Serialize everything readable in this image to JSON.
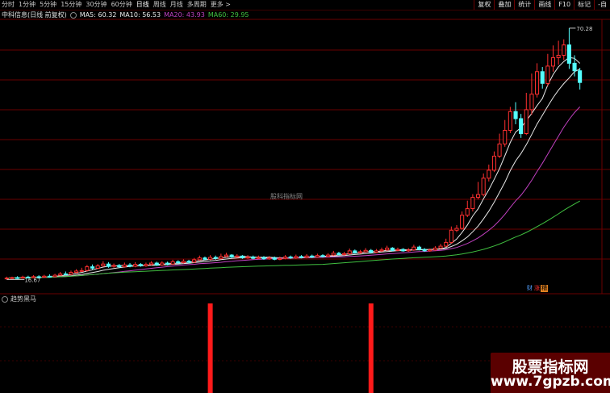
{
  "toolbar": {
    "tabs": [
      "分时",
      "1分钟",
      "5分钟",
      "15分钟",
      "30分钟",
      "60分钟",
      "日线",
      "周线",
      "月线",
      "多周期",
      "更多 >"
    ],
    "active_tab": "日线",
    "right_buttons": [
      "复权",
      "叠加",
      "统计",
      "画线",
      "F10",
      "标记",
      "-自"
    ]
  },
  "info": {
    "title": "中科信息(日线 前复权)",
    "ma5": "MA5: 60.32",
    "ma10": "MA10: 56.53",
    "ma20": "MA20: 43.93",
    "ma60": "MA60: 29.95"
  },
  "colors": {
    "ma5": "#e8e8e8",
    "ma10": "#e8e8e8",
    "ma20": "#c040c0",
    "ma60": "#40c040",
    "up": "#ff3030",
    "down": "#54ffff",
    "signal": "#ff1a1a",
    "grid": "#6a0000"
  },
  "chart_annotations": {
    "high_label": "70.28",
    "low_label": "16.67",
    "watermark": "股科指标网"
  },
  "badges": [
    "财",
    "涨",
    "糟"
  ],
  "indicator": {
    "title": "趋势黑马"
  },
  "logo": {
    "line1": "股票指标网",
    "line2": "www.7gpzb.com"
  },
  "chart_data": {
    "type": "candlestick",
    "price_axis": {
      "low": 16.67,
      "high": 70.28
    },
    "candles": [
      [
        16.9,
        17.0,
        17.3,
        16.7
      ],
      [
        17.0,
        17.1,
        17.3,
        16.8
      ],
      [
        17.1,
        17.0,
        17.4,
        16.8
      ],
      [
        17.0,
        17.2,
        17.5,
        16.9
      ],
      [
        17.2,
        17.1,
        17.5,
        17.0
      ],
      [
        17.1,
        17.3,
        17.6,
        17.0
      ],
      [
        17.3,
        17.2,
        17.6,
        17.0
      ],
      [
        17.2,
        17.4,
        17.7,
        17.1
      ],
      [
        17.4,
        17.3,
        17.8,
        17.1
      ],
      [
        17.3,
        17.6,
        17.9,
        17.2
      ],
      [
        17.6,
        17.9,
        18.3,
        17.5
      ],
      [
        17.9,
        17.8,
        18.4,
        17.6
      ],
      [
        17.8,
        18.2,
        18.6,
        17.7
      ],
      [
        18.2,
        18.5,
        18.9,
        18.0
      ],
      [
        18.5,
        18.6,
        19.2,
        18.3
      ],
      [
        18.6,
        19.4,
        19.8,
        18.4
      ],
      [
        19.4,
        19.1,
        19.9,
        18.8
      ],
      [
        19.1,
        19.6,
        20.0,
        18.9
      ],
      [
        19.6,
        20.0,
        20.6,
        19.4
      ],
      [
        20.0,
        19.5,
        20.4,
        19.2
      ],
      [
        19.5,
        19.7,
        20.1,
        19.2
      ],
      [
        19.7,
        19.4,
        20.0,
        19.1
      ],
      [
        19.4,
        19.8,
        20.3,
        19.2
      ],
      [
        19.8,
        19.5,
        20.2,
        19.3
      ],
      [
        19.5,
        19.9,
        20.4,
        19.3
      ],
      [
        19.9,
        19.6,
        20.2,
        19.4
      ],
      [
        19.6,
        19.9,
        20.3,
        19.4
      ],
      [
        19.9,
        20.2,
        20.6,
        19.7
      ],
      [
        20.2,
        19.8,
        20.5,
        19.6
      ],
      [
        19.8,
        20.2,
        20.6,
        19.6
      ],
      [
        20.2,
        20.0,
        20.5,
        19.7
      ],
      [
        20.0,
        20.5,
        20.9,
        19.8
      ],
      [
        20.5,
        20.3,
        20.8,
        20.0
      ],
      [
        20.3,
        20.6,
        21.0,
        20.1
      ],
      [
        20.6,
        20.4,
        20.9,
        20.1
      ],
      [
        20.4,
        20.9,
        21.3,
        20.2
      ],
      [
        20.9,
        21.3,
        21.8,
        20.7
      ],
      [
        21.3,
        21.0,
        21.6,
        20.8
      ],
      [
        21.0,
        21.4,
        21.9,
        20.8
      ],
      [
        21.4,
        21.2,
        21.8,
        20.9
      ],
      [
        21.2,
        21.6,
        22.2,
        21.0
      ],
      [
        21.6,
        21.9,
        22.4,
        21.4
      ],
      [
        21.9,
        21.5,
        22.1,
        21.3
      ],
      [
        21.5,
        21.7,
        22.1,
        21.3
      ],
      [
        21.7,
        21.3,
        21.9,
        21.1
      ],
      [
        21.3,
        21.5,
        21.9,
        21.1
      ],
      [
        21.5,
        21.2,
        21.8,
        21.0
      ],
      [
        21.2,
        21.4,
        21.8,
        21.0
      ],
      [
        21.4,
        21.1,
        21.7,
        20.9
      ],
      [
        21.1,
        21.3,
        21.7,
        20.9
      ],
      [
        21.3,
        21.0,
        21.6,
        20.8
      ],
      [
        21.0,
        21.2,
        21.6,
        20.8
      ],
      [
        21.2,
        21.5,
        21.9,
        21.0
      ],
      [
        21.5,
        21.3,
        21.8,
        21.1
      ],
      [
        21.3,
        21.6,
        22.0,
        21.1
      ],
      [
        21.6,
        21.4,
        21.9,
        21.2
      ],
      [
        21.4,
        21.7,
        22.1,
        21.2
      ],
      [
        21.7,
        21.5,
        22.0,
        21.3
      ],
      [
        21.5,
        21.8,
        22.2,
        21.3
      ],
      [
        21.8,
        21.6,
        22.1,
        21.4
      ],
      [
        21.6,
        21.9,
        22.3,
        21.4
      ],
      [
        21.9,
        22.3,
        22.8,
        21.7
      ],
      [
        22.3,
        22.0,
        22.6,
        21.8
      ],
      [
        22.0,
        22.2,
        22.6,
        21.8
      ],
      [
        22.2,
        22.8,
        23.3,
        22.0
      ],
      [
        22.8,
        22.4,
        23.1,
        22.2
      ],
      [
        22.4,
        22.6,
        23.0,
        22.2
      ],
      [
        22.6,
        22.9,
        23.4,
        22.4
      ],
      [
        22.9,
        22.5,
        23.2,
        22.3
      ],
      [
        22.5,
        22.8,
        23.2,
        22.3
      ],
      [
        22.8,
        23.0,
        23.5,
        22.6
      ],
      [
        23.0,
        23.4,
        23.9,
        22.8
      ],
      [
        23.4,
        22.9,
        23.6,
        22.7
      ],
      [
        22.9,
        23.1,
        23.5,
        22.7
      ],
      [
        23.1,
        22.8,
        23.4,
        22.6
      ],
      [
        22.8,
        23.0,
        23.4,
        22.6
      ],
      [
        23.0,
        23.6,
        24.1,
        22.8
      ],
      [
        23.6,
        23.1,
        23.9,
        22.9
      ],
      [
        23.1,
        22.8,
        23.4,
        22.6
      ],
      [
        22.8,
        23.0,
        23.3,
        22.6
      ],
      [
        23.0,
        23.4,
        23.8,
        22.8
      ],
      [
        23.4,
        23.8,
        24.3,
        23.2
      ],
      [
        23.8,
        24.6,
        25.4,
        23.6
      ],
      [
        24.6,
        27.2,
        28.0,
        24.3
      ],
      [
        27.2,
        27.6,
        28.3,
        26.8
      ],
      [
        27.6,
        30.4,
        31.2,
        27.3
      ],
      [
        30.4,
        31.8,
        33.5,
        30.0
      ],
      [
        31.8,
        34.2,
        34.9,
        31.2
      ],
      [
        34.2,
        34.8,
        37.5,
        33.8
      ],
      [
        34.8,
        38.3,
        39.3,
        34.4
      ],
      [
        38.3,
        40.0,
        41.2,
        37.6
      ],
      [
        40.0,
        43.0,
        44.0,
        39.6
      ],
      [
        43.0,
        45.6,
        47.8,
        42.6
      ],
      [
        45.6,
        48.5,
        50.7,
        45.0
      ],
      [
        48.5,
        52.5,
        53.5,
        47.9
      ],
      [
        52.5,
        51.0,
        54.5,
        49.8
      ],
      [
        51.0,
        47.8,
        52.0,
        46.9
      ],
      [
        47.8,
        52.9,
        56.5,
        47.5
      ],
      [
        52.9,
        56.2,
        60.6,
        51.8
      ],
      [
        56.2,
        61.0,
        62.8,
        55.5
      ],
      [
        61.0,
        58.5,
        62.0,
        57.4
      ],
      [
        58.5,
        62.2,
        64.8,
        57.9
      ],
      [
        62.2,
        64.0,
        66.6,
        61.0
      ],
      [
        64.0,
        64.5,
        67.6,
        62.5
      ],
      [
        64.5,
        66.7,
        67.9,
        63.5
      ],
      [
        66.7,
        62.8,
        70.28,
        61.6
      ],
      [
        62.8,
        61.2,
        64.5,
        60.0
      ],
      [
        61.2,
        58.7,
        61.8,
        57.2
      ]
    ],
    "signals": [
      {
        "bar_index": 38
      },
      {
        "bar_index": 68
      }
    ]
  }
}
